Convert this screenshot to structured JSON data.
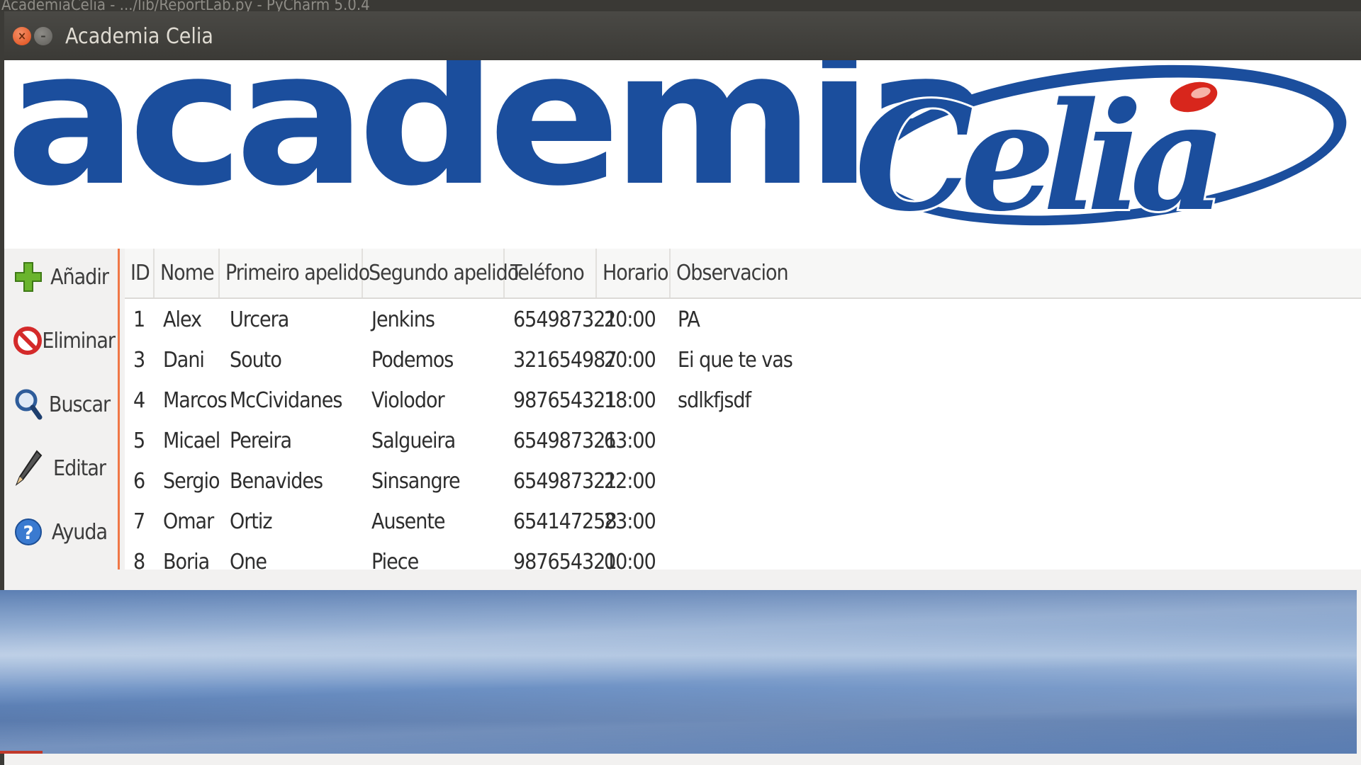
{
  "behind_window_title": "AcademiaCelia - .../lib/ReportLab.py - PyCharm 5.0.4",
  "window": {
    "title": "Academia Celia"
  },
  "banner": {
    "word1": "academia",
    "word2": "Celia"
  },
  "sidebar": {
    "items": [
      {
        "label": "Añadir",
        "icon": "add-icon",
        "color": "#6ab42d"
      },
      {
        "label": "Eliminar",
        "icon": "delete-icon",
        "color": "#d42a2a"
      },
      {
        "label": "Buscar",
        "icon": "search-icon",
        "color": "#2e5c9a"
      },
      {
        "label": "Editar",
        "icon": "pencil-icon",
        "color": "#333333"
      },
      {
        "label": "Ayuda",
        "icon": "help-icon",
        "color": "#3a7ad0"
      }
    ]
  },
  "table": {
    "columns": [
      "ID",
      "Nome",
      "Primeiro apelido",
      "Segundo apelido",
      "Teléfono",
      "Horario",
      "Observacion"
    ],
    "rows": [
      [
        "1",
        "Alex",
        "Urcera",
        "Jenkins",
        "654987321",
        "20:00",
        "PA"
      ],
      [
        "3",
        "Dani",
        "Souto",
        "Podemos",
        "321654987",
        "20:00",
        "Ei que te vas"
      ],
      [
        "4",
        "Marcos",
        "McCividanes",
        "Violodor",
        "987654321",
        "18:00",
        "sdlkfjsdf"
      ],
      [
        "5",
        "Micael",
        "Pereira",
        "Salgueira",
        "654987321",
        "63:00",
        ""
      ],
      [
        "6",
        "Sergio",
        "Benavides",
        "Sinsangre",
        "654987321",
        "22:00",
        ""
      ],
      [
        "7",
        "Omar",
        "Ortiz",
        "Ausente",
        "654147258",
        "23:00",
        ""
      ],
      [
        "8",
        "Boria",
        "One",
        "Piece",
        "987654321",
        "00:00",
        ""
      ]
    ]
  },
  "colors": {
    "brand_blue": "#1b4e9d",
    "accent_orange": "#f07746",
    "close_button": "#df4a16"
  }
}
